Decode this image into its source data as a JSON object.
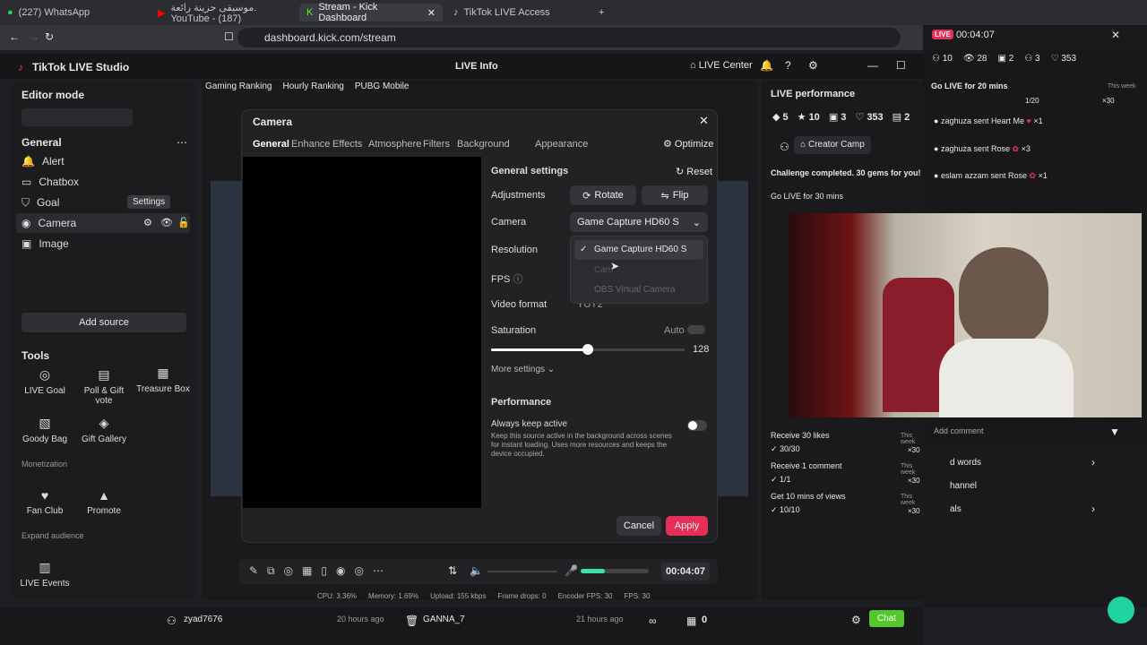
{
  "browser": {
    "tabs": [
      "(227) WhatsApp",
      "موسيقى حزينة رائعة. YouTube - (187)",
      "Stream - Kick Dashboard",
      "TikTok LIVE Access"
    ],
    "url": "dashboard.kick.com/stream"
  },
  "app": {
    "title": "TikTok LIVE Studio",
    "live_info": "LIVE Info",
    "live_center": "LIVE Center",
    "rankings": [
      "Gaming Ranking",
      "Hourly Ranking",
      "PUBG Mobile"
    ]
  },
  "left": {
    "editor_mode": "Editor mode",
    "general": "General",
    "sources": [
      "Alert",
      "Chatbox",
      "Goal",
      "Camera",
      "Image"
    ],
    "tooltip": "Settings",
    "add_source": "Add source",
    "tools": "Tools",
    "tools_items": [
      "LIVE Goal",
      "Poll & Gift vote",
      "Treasure Box",
      "Goody Bag",
      "Gift Gallery"
    ],
    "monetization": "Monetization",
    "monet_items": [
      "Fan Club",
      "Promote"
    ],
    "expand": "Expand audience",
    "expand_items": [
      "LIVE Events"
    ]
  },
  "modal": {
    "title": "Camera",
    "tabs": [
      "General",
      "Enhance",
      "Effects",
      "Atmosphere",
      "Filters",
      "Background",
      "Appearance"
    ],
    "optimize": "Optimize",
    "general_settings": "General settings",
    "reset": "Reset",
    "adjustments": "Adjustments",
    "rotate": "Rotate",
    "flip": "Flip",
    "camera": "Camera",
    "camera_value": "Game Capture HD60 S",
    "resolution": "Resolution",
    "fps": "FPS",
    "video_format": "Video format",
    "video_format_value": "YUY2",
    "dropdown_options": [
      "Game Capture HD60 S",
      "Cam",
      "OBS Virtual Camera"
    ],
    "saturation": "Saturation",
    "auto": "Auto",
    "saturation_value": "128",
    "more_settings": "More settings",
    "performance": "Performance",
    "always_active": "Always keep active",
    "always_desc": "Keep this source active in the background across scenes for instant loading. Uses more resources and keeps the device occupied.",
    "cancel": "Cancel",
    "apply": "Apply"
  },
  "controls": {
    "timer": "00:04:07",
    "stats": [
      "CPU: 3.36%",
      "Memory: 1.69%",
      "Upload: 155 kbps",
      "Frame drops: 0",
      "Encoder FPS: 30",
      "FPS: 30"
    ]
  },
  "right": {
    "title": "LIVE performance",
    "stats": [
      "5",
      "10",
      "3",
      "353",
      "2"
    ],
    "creator_camp": "Creator Camp",
    "challenge": "Challenge completed. 30 gems for you!",
    "tasks": [
      {
        "t": "Go LIVE for 30 mins"
      },
      {
        "t": "Receive 30 likes",
        "p": "30/30",
        "w": "This week",
        "r": "×30"
      },
      {
        "t": "Receive 1 comment",
        "p": "1/1",
        "w": "This week",
        "r": "×30"
      },
      {
        "t": "Get 10 mins of views",
        "p": "10/10",
        "w": "This week",
        "r": "×30"
      }
    ]
  },
  "overlay": {
    "live": "LIVE",
    "timer": "00:04:07",
    "stats": [
      "10",
      "28",
      "2",
      "3",
      "353"
    ],
    "go_live": "Go LIVE for 20 mins",
    "this_week": "This week",
    "progress": "1/20",
    "reward": "×30",
    "gifts": [
      {
        "user": "zaghuza",
        "msg": "sent Heart Me",
        "x": "×1"
      },
      {
        "user": "zaghuza",
        "msg": "sent Rose",
        "x": "×3"
      },
      {
        "user": "eslam azzam",
        "msg": "sent Rose",
        "x": "×1"
      }
    ],
    "add_comment": "Add comment",
    "side_links": [
      "d words",
      "hannel",
      "als"
    ]
  },
  "bottom": {
    "user1": "zyad7676",
    "time1": "20 hours ago",
    "user2": "GANNA_7",
    "time2": "21 hours ago",
    "count": "0",
    "chat": "Chat"
  }
}
